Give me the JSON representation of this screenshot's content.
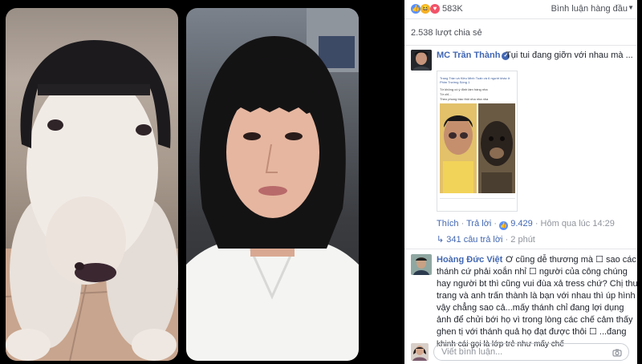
{
  "reactions": {
    "count": "583K",
    "types": [
      "like",
      "haha",
      "love"
    ]
  },
  "sort": {
    "label": "Bình luận hàng đầu"
  },
  "shares": "2.538 lượt chia sẻ",
  "comments": [
    {
      "author": "MC Trần Thành",
      "verified": true,
      "text": "Tụi tui đang giỡn với nhau mà ...",
      "image": {
        "header": "Trang Trần và Kiều Minh Tuấn và 6 người khác ở Phim Trường Sóng 1",
        "line1": "Tớ không có ý định làm hàng nha",
        "line2": "Tớ chỉ...",
        "line3": "Theo phong trào thôi nha nha nha"
      },
      "actions": {
        "like": "Thích",
        "reply": "Trả lời",
        "likes": "9.429",
        "time": "Hôm qua lúc 14:29"
      },
      "replies": "341 câu trả lời",
      "replies_time": "2 phút"
    },
    {
      "author": "Hoàng Đức Việt",
      "verified": false,
      "lines": [
        "Ơ cũng dễ thương mà ☐ sao các",
        "thánh cứ phải xoắn nhỉ ☐ người của công chúng",
        "hay người bt thì cũng vui đùa xả tress chứ? Chị thu",
        "trang và anh trấn thành là bạn với nhau thì úp hình",
        "vậy chẳng sao cả...mấy thánh chỉ đang lợi dụng",
        "ảnh để chửi bới họ vì trong lòng các chế cảm thấy",
        "ghen tị với thánh quả họ đạt được thôi ☐ ...đang",
        "khinh cái gọi là lớp trẻ như mấy chế"
      ]
    }
  ],
  "compose": {
    "placeholder": "Viết bình luận..."
  },
  "colors": {
    "link": "#4267b2",
    "like": "#5890ff",
    "love": "#f25268",
    "haha": "#f7b125"
  }
}
